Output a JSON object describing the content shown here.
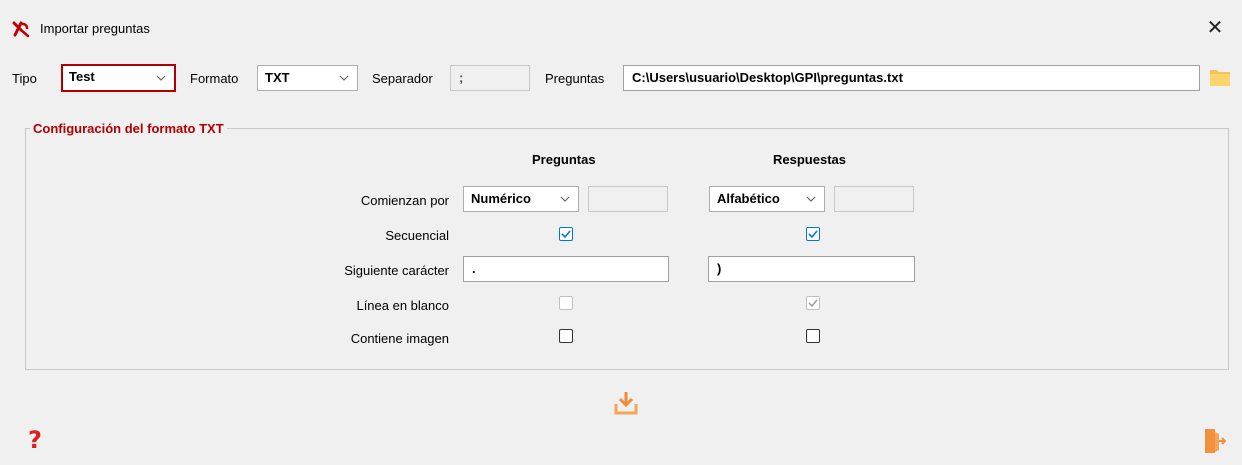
{
  "window": {
    "title": "Importar preguntas",
    "close_glyph": "✕"
  },
  "toolbar": {
    "tipo_label": "Tipo",
    "tipo_value": "Test",
    "formato_label": "Formato",
    "formato_value": "TXT",
    "separador_label": "Separador",
    "separador_value": ";",
    "preguntas_label": "Preguntas",
    "preguntas_path": "C:\\Users\\usuario\\Desktop\\GPI\\preguntas.txt",
    "folder_icon": "folder-icon"
  },
  "config": {
    "group_title": "Configuración del formato TXT",
    "col_preguntas": "Preguntas",
    "col_respuestas": "Respuestas",
    "rows": {
      "comienzan_label": "Comienzan por",
      "preguntas_comienzan": "Numérico",
      "respuestas_comienzan": "Alfabético",
      "secuencial_label": "Secuencial",
      "siguiente_label": "Siguiente carácter",
      "preguntas_siguiente": ".",
      "respuestas_siguiente": ")",
      "linea_label": "Línea en blanco",
      "imagen_label": "Contiene imagen"
    },
    "checks": {
      "preguntas_secuencial": true,
      "respuestas_secuencial": true,
      "preguntas_linea": false,
      "respuestas_linea": true,
      "preguntas_imagen": false,
      "respuestas_imagen": false
    }
  },
  "footer": {
    "help_glyph": "?",
    "download_icon": "download-icon",
    "exit_icon": "exit-icon"
  },
  "colors": {
    "accent": "#b00000",
    "icon_orange": "#f5a55a",
    "check_blue": "#0078d7",
    "help_red": "#e02020"
  }
}
